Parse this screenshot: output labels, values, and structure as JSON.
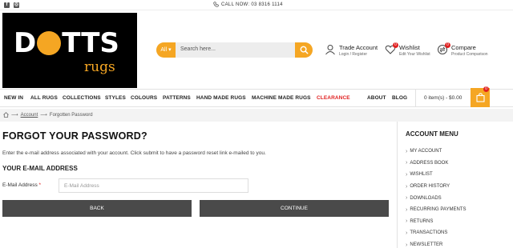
{
  "topbar": {
    "call_label": "CALL NOW: 03 8316 1114",
    "social": [
      "facebook-icon",
      "instagram-icon"
    ]
  },
  "logo": {
    "word": "DOTTS",
    "sub": "rugs",
    "accent": "#f5a623"
  },
  "search": {
    "category": "All",
    "placeholder": "Search here..."
  },
  "header": {
    "trade_title": "Trade Account",
    "trade_sub": "Login / Register",
    "wishlist_title": "Wishlist",
    "wishlist_sub": "Edit Your Wishlist",
    "wishlist_count": "0",
    "compare_title": "Compare",
    "compare_sub": "Product Comparison",
    "compare_count": "0"
  },
  "nav": {
    "items": [
      "NEW IN",
      "ALL RUGS",
      "COLLECTIONS",
      "STYLES",
      "COLOURS",
      "PATTERNS",
      "HAND MADE RUGS",
      "MACHINE MADE RUGS",
      "CLEARANCE",
      "ABOUT",
      "BLOG"
    ],
    "cart_text": "0 item(s) - $0.00",
    "cart_count": "0"
  },
  "breadcrumb": {
    "account": "Account",
    "current": "Forgotten Password"
  },
  "main": {
    "title": "FORGOT YOUR PASSWORD?",
    "intro": "Enter the e-mail address associated with your account. Click submit to have a password reset link e-mailed to you.",
    "section": "YOUR E-MAIL ADDRESS",
    "email_label": "E-Mail Address",
    "email_required": "*",
    "email_placeholder": "E-Mail Address",
    "back_label": "BACK",
    "continue_label": "CONTINUE"
  },
  "sidebar": {
    "title": "ACCOUNT MENU",
    "items": [
      "MY ACCOUNT",
      "ADDRESS BOOK",
      "WISHLIST",
      "ORDER HISTORY",
      "DOWNLOADS",
      "RECURRING PAYMENTS",
      "RETURNS",
      "TRANSACTIONS",
      "NEWSLETTER"
    ]
  },
  "colors": {
    "accent": "#f5a623",
    "dark_button": "#4a4a4a",
    "clearance": "#e02020"
  }
}
